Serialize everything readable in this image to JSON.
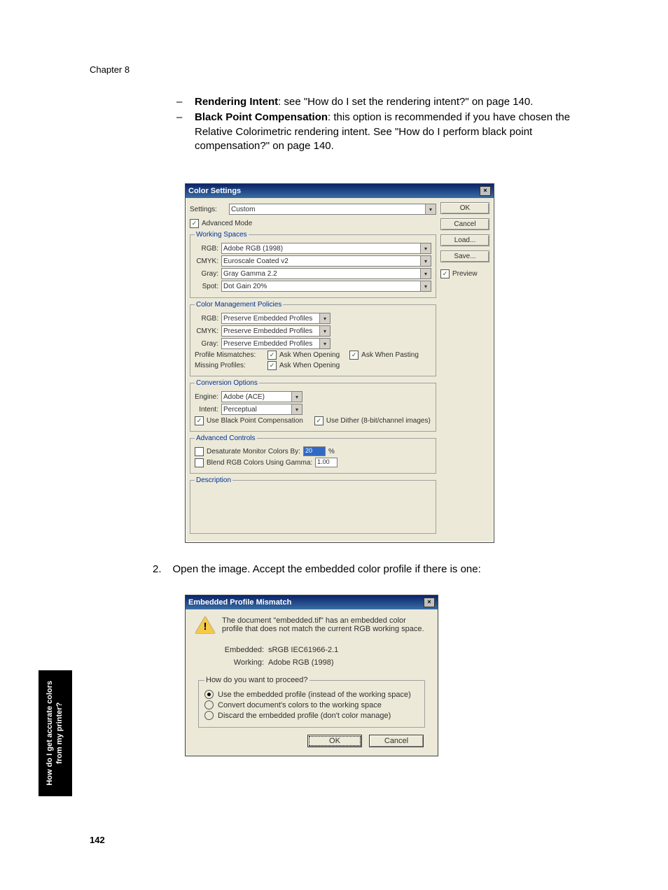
{
  "chapter": "Chapter 8",
  "bullets": {
    "b1_title": "Rendering Intent",
    "b1_rest": ": see \"How do I set the rendering intent?\" on page 140.",
    "b2_title": "Black Point Compensation",
    "b2_rest": ": this option is recommended if you have chosen the Relative Colorimetric rendering intent. See \"How do I perform black point compensation?\" on page 140."
  },
  "dlg1": {
    "title": "Color Settings",
    "settings_label": "Settings:",
    "settings_value": "Custom",
    "advanced_mode": "Advanced Mode",
    "buttons": {
      "ok": "OK",
      "cancel": "Cancel",
      "load": "Load...",
      "save": "Save..."
    },
    "preview": "Preview",
    "ws": {
      "legend": "Working Spaces",
      "rgb_l": "RGB:",
      "rgb_v": "Adobe RGB (1998)",
      "cmyk_l": "CMYK:",
      "cmyk_v": "Euroscale Coated v2",
      "gray_l": "Gray:",
      "gray_v": "Gray Gamma 2.2",
      "spot_l": "Spot:",
      "spot_v": "Dot Gain 20%"
    },
    "cmp": {
      "legend": "Color Management Policies",
      "rgb_l": "RGB:",
      "rgb_v": "Preserve Embedded Profiles",
      "cmyk_l": "CMYK:",
      "cmyk_v": "Preserve Embedded Profiles",
      "gray_l": "Gray:",
      "gray_v": "Preserve Embedded Profiles",
      "mis_l": "Profile Mismatches:",
      "mis_o": "Ask When Opening",
      "mis_p": "Ask When Pasting",
      "miss_l": "Missing Profiles:",
      "miss_o": "Ask When Opening"
    },
    "conv": {
      "legend": "Conversion Options",
      "eng_l": "Engine:",
      "eng_v": "Adobe (ACE)",
      "int_l": "Intent:",
      "int_v": "Perceptual",
      "bpc": "Use Black Point Compensation",
      "dith": "Use Dither (8-bit/channel images)"
    },
    "adv": {
      "legend": "Advanced Controls",
      "desat": "Desaturate Monitor Colors By:",
      "desat_v": "20",
      "pct": "%",
      "blend": "Blend RGB Colors Using Gamma:",
      "blend_v": "1.00"
    },
    "desc": {
      "legend": "Description"
    }
  },
  "step2": {
    "num": "2.",
    "text": "Open the image. Accept the embedded color profile if there is one:"
  },
  "dlg2": {
    "title": "Embedded Profile Mismatch",
    "msg": "The document \"embedded.tif\" has an embedded color profile that does not match the current RGB working space.",
    "emb_l": "Embedded:",
    "emb_v": "sRGB IEC61966-2.1",
    "work_l": "Working:",
    "work_v": "Adobe RGB (1998)",
    "proceed": "How do you want to proceed?",
    "r1": "Use the embedded profile (instead of the working space)",
    "r2": "Convert document's colors to the working space",
    "r3": "Discard the embedded profile (don't color manage)",
    "ok": "OK",
    "cancel": "Cancel"
  },
  "side_tab": {
    "line1": "How do I get accurate colors",
    "line2": "from my printer?"
  },
  "page_number": "142"
}
